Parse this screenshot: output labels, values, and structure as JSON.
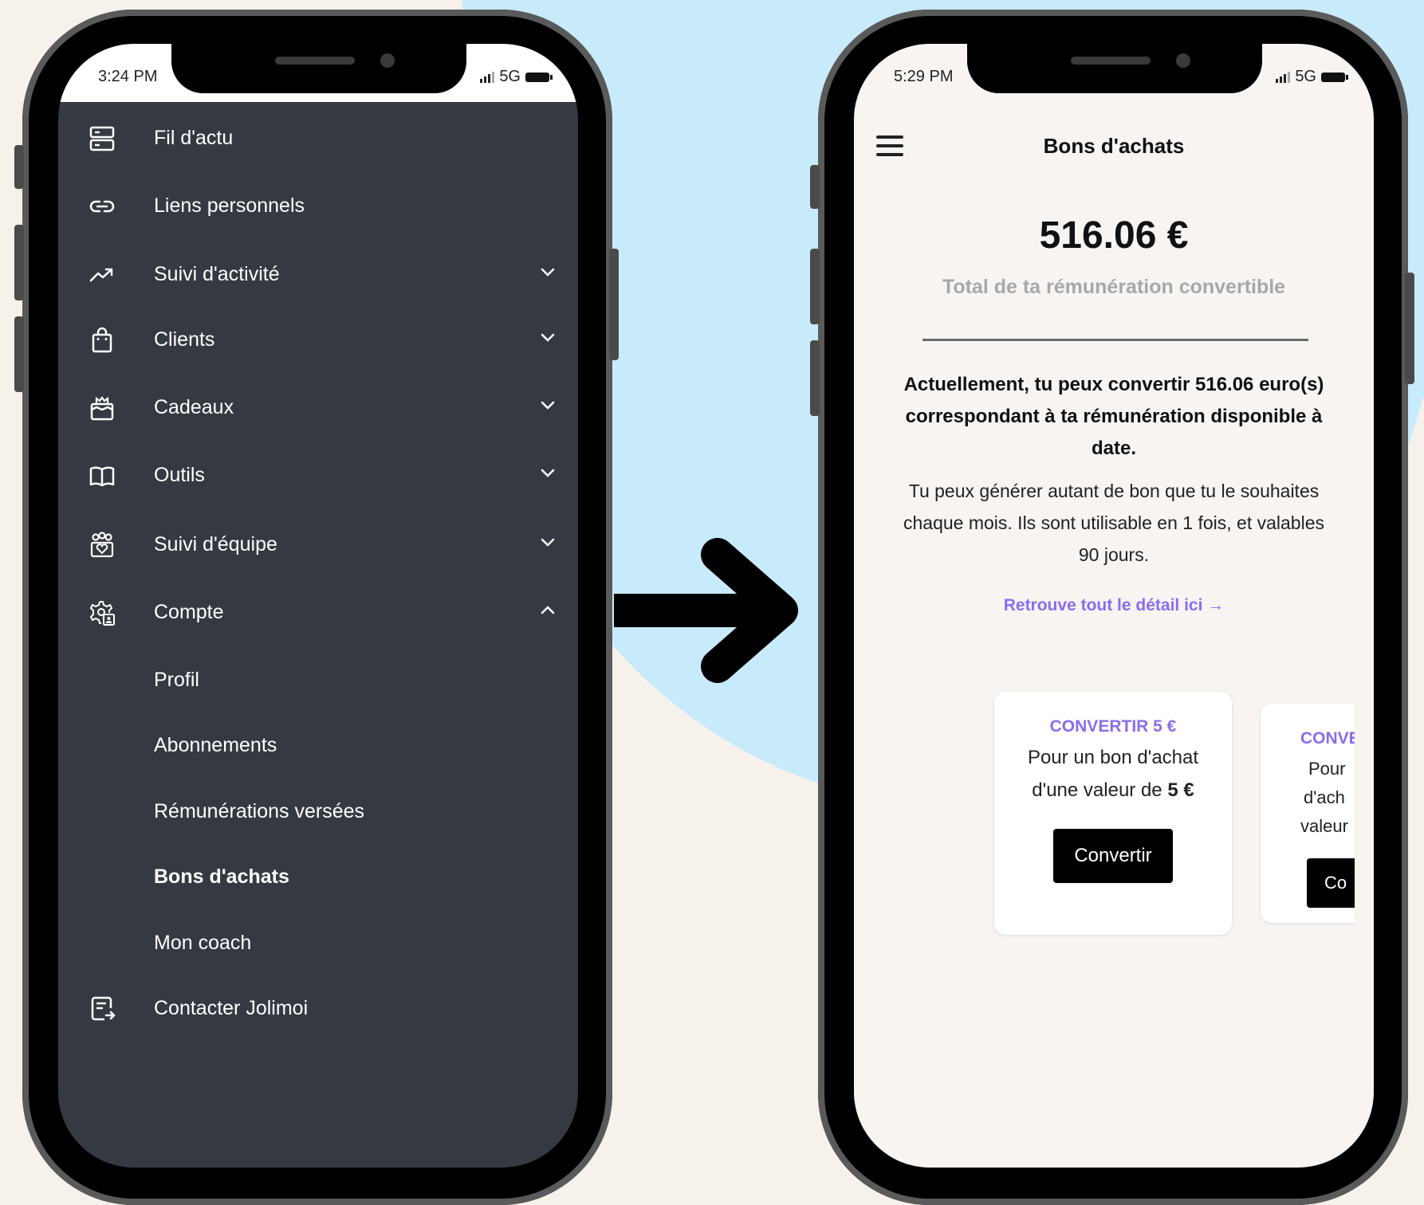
{
  "left_phone": {
    "status": {
      "time": "3:24 PM",
      "network": "5G"
    },
    "menu": [
      {
        "id": "fil",
        "label": "Fil d'actu",
        "icon": "news-feed-icon",
        "expandable": false
      },
      {
        "id": "liens",
        "label": "Liens personnels",
        "icon": "link-icon",
        "expandable": false
      },
      {
        "id": "suivi",
        "label": "Suivi d'activité",
        "icon": "trend-up-icon",
        "expandable": true,
        "expanded": false
      },
      {
        "id": "clients",
        "label": "Clients",
        "icon": "shopping-bag-icon",
        "expandable": true,
        "expanded": false
      },
      {
        "id": "cadeaux",
        "label": "Cadeaux",
        "icon": "gift-box-icon",
        "expandable": true,
        "expanded": false
      },
      {
        "id": "outils",
        "label": "Outils",
        "icon": "open-book-icon",
        "expandable": true,
        "expanded": false
      },
      {
        "id": "equipe",
        "label": "Suivi d'équipe",
        "icon": "team-icon",
        "expandable": true,
        "expanded": false
      },
      {
        "id": "compte",
        "label": "Compte",
        "icon": "account-settings-icon",
        "expandable": true,
        "expanded": true
      },
      {
        "id": "profil",
        "label": "Profil",
        "sub": true
      },
      {
        "id": "abonnements",
        "label": "Abonnements",
        "sub": true
      },
      {
        "id": "remun",
        "label": "Rémunérations versées",
        "sub": true
      },
      {
        "id": "bons",
        "label": "Bons d'achats",
        "sub": true,
        "active": true
      },
      {
        "id": "coach",
        "label": "Mon coach",
        "sub": true
      },
      {
        "id": "contact",
        "label": "Contacter Jolimoi",
        "icon": "contact-form-icon"
      }
    ]
  },
  "right_phone": {
    "status": {
      "time": "5:29 PM",
      "network": "5G"
    },
    "title": "Bons d'achats",
    "amount": "516.06 €",
    "amount_caption": "Total de ta rémunération convertible",
    "message_bold": "Actuellement, tu peux convertir 516.06 euro(s) correspondant à ta rémunération disponible à date.",
    "message": "Tu peux générer autant de bon que tu le souhaites chaque mois. Ils sont utilisable en 1 fois, et valables 90 jours.",
    "link": "Retrouve tout le détail ici →",
    "cards": [
      {
        "title": "CONVERTIR 5 €",
        "desc_prefix": "Pour un bon d'achat d'une valeur de",
        "desc_value": "5 €",
        "button": "Convertir"
      },
      {
        "title": "CONVE",
        "desc_lines": [
          "Pour",
          "d'ach",
          "valeur"
        ],
        "button": "Co"
      }
    ]
  },
  "colors": {
    "menu_bg": "#353a42",
    "accent": "#8a6cf0",
    "backdrop": "#c8ebfc",
    "page_bg": "#f7f1ec"
  }
}
